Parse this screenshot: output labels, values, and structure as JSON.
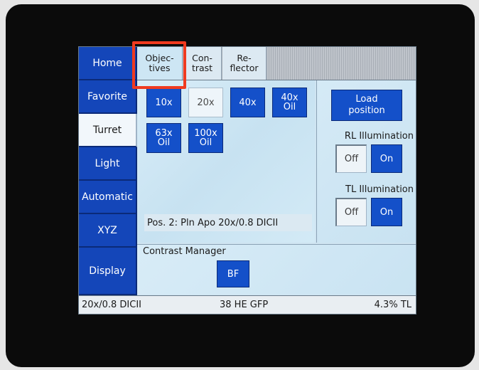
{
  "nav": {
    "items": [
      {
        "label": "Home"
      },
      {
        "label": "Favorite"
      },
      {
        "label": "Turret"
      },
      {
        "label": "Light"
      },
      {
        "label": "Automatic"
      },
      {
        "label": "XYZ"
      },
      {
        "label": "Display"
      }
    ],
    "active_index": 2
  },
  "tabs": [
    {
      "label": "Objec-\ntives"
    },
    {
      "label": "Con-\ntrast"
    },
    {
      "label": "Re-\nflector"
    }
  ],
  "objectives": {
    "buttons": [
      {
        "label": "10x"
      },
      {
        "label": "20x"
      },
      {
        "label": "40x"
      },
      {
        "label": "40x\nOil"
      },
      {
        "label": "63x\nOil"
      },
      {
        "label": "100x\nOil"
      }
    ],
    "selected_label": "20x",
    "position_text": "Pos. 2: Pln Apo 20x/0.8 DICII"
  },
  "right_panel": {
    "load_position_label": "Load\nposition",
    "rl_label": "RL Illumination",
    "tl_label": "TL Illumination",
    "off_label": "Off",
    "on_label": "On"
  },
  "contrast_manager": {
    "title": "Contrast Manager",
    "button": "BF"
  },
  "status_bar": {
    "objective": "20x/0.8 DICII",
    "filter": "38 HE GFP",
    "light": "4.3% TL"
  },
  "colors": {
    "button_blue": "#1450c9",
    "highlight_red": "#f03a1f",
    "panel_bg": "#cfe4f1"
  }
}
